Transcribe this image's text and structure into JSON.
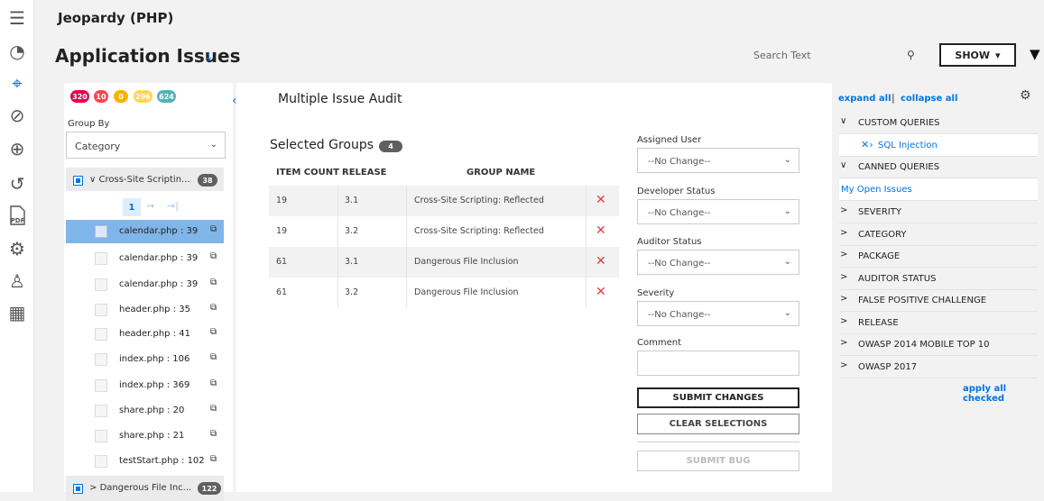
{
  "rail": {
    "icons": [
      "menu-icon",
      "dashboard-icon",
      "target-icon",
      "gauge-icon",
      "globe-search-icon",
      "history-icon",
      "pdf-icon",
      "settings-icon",
      "users-key-icon",
      "clipboard-icon"
    ],
    "glyphs": [
      "☰",
      "◔",
      "⌖",
      "⊘",
      "⊕",
      "↺",
      "▤",
      "⚙",
      "♙",
      "▦"
    ],
    "pdf_label": "PDF"
  },
  "header": {
    "app_name": "Jeopardy (PHP)",
    "page_title": "Application Issues",
    "download_glyph": "⤓",
    "search_placeholder": "Search Text",
    "search_glyph": "⚲",
    "show_label": "SHOW",
    "show_caret": "▾",
    "filter_glyph": "▼"
  },
  "left": {
    "severity_counts": [
      {
        "value": "320",
        "color": "#e5004c"
      },
      {
        "value": "10",
        "color": "#ff454f"
      },
      {
        "value": "0",
        "color": "#ffb000"
      },
      {
        "value": "296",
        "color": "#ffd552"
      },
      {
        "value": "624",
        "color": "#53b3b3"
      }
    ],
    "collapse_glyph": "‹",
    "group_by_label": "Group By",
    "group_by_value": "Category",
    "chevron": "⌄",
    "group1": {
      "label": "Cross-Site Scriptin...",
      "count": "38",
      "caret": "∨"
    },
    "pager": {
      "page": "1",
      "next": "→",
      "last": "→|"
    },
    "files": [
      {
        "name": "calendar.php : 39",
        "selected": true
      },
      {
        "name": "calendar.php : 39",
        "selected": false
      },
      {
        "name": "calendar.php : 39",
        "selected": false
      },
      {
        "name": "header.php : 35",
        "selected": false
      },
      {
        "name": "header.php : 41",
        "selected": false
      },
      {
        "name": "index.php : 106",
        "selected": false
      },
      {
        "name": "index.php : 369",
        "selected": false
      },
      {
        "name": "share.php : 20",
        "selected": false
      },
      {
        "name": "share.php : 21",
        "selected": false
      },
      {
        "name": "testStart.php : 102",
        "selected": false
      }
    ],
    "copy_glyph": "⧉",
    "group2": {
      "label": "Dangerous File Inc...",
      "count": "122",
      "caret": ">"
    }
  },
  "center": {
    "title": "Multiple Issue Audit",
    "selected_groups_label": "Selected Groups",
    "selected_groups_count": "4",
    "columns": {
      "item_count": "ITEM COUNT",
      "release": "RELEASE",
      "group_name": "GROUP NAME"
    },
    "rows": [
      {
        "count": "19",
        "release": "3.1",
        "group": "Cross-Site Scripting: Reflected"
      },
      {
        "count": "19",
        "release": "3.2",
        "group": "Cross-Site Scripting: Reflected"
      },
      {
        "count": "61",
        "release": "3.1",
        "group": "Dangerous File Inclusion"
      },
      {
        "count": "61",
        "release": "3.2",
        "group": "Dangerous File Inclusion"
      }
    ],
    "remove_glyph": "✕",
    "form": {
      "assigned_user_label": "Assigned User",
      "assigned_user_value": "--No Change--",
      "developer_status_label": "Developer Status",
      "developer_status_value": "--No Change--",
      "auditor_status_label": "Auditor Status",
      "auditor_status_value": "--No Change--",
      "severity_label": "Severity",
      "severity_value": "--No Change--",
      "comment_label": "Comment",
      "submit_label": "SUBMIT CHANGES",
      "clear_label": "CLEAR SELECTIONS",
      "bug_label": "SUBMIT BUG"
    }
  },
  "right": {
    "expand_all": "expand all",
    "separator": "|",
    "collapse_all": "collapse all",
    "gear_glyph": "⚙",
    "open_chevron": "∨",
    "closed_chevron": ">",
    "custom_queries": "CUSTOM QUERIES",
    "sql_injection": "SQL Injection",
    "sql_icon": "✕›",
    "canned_queries": "CANNED QUERIES",
    "my_open_issues": "My Open Issues",
    "filters": [
      "SEVERITY",
      "CATEGORY",
      "PACKAGE",
      "AUDITOR STATUS",
      "FALSE POSITIVE CHALLENGE",
      "RELEASE",
      "OWASP 2014 MOBILE TOP 10",
      "OWASP 2017"
    ],
    "apply_all_checked": "apply all checked"
  }
}
